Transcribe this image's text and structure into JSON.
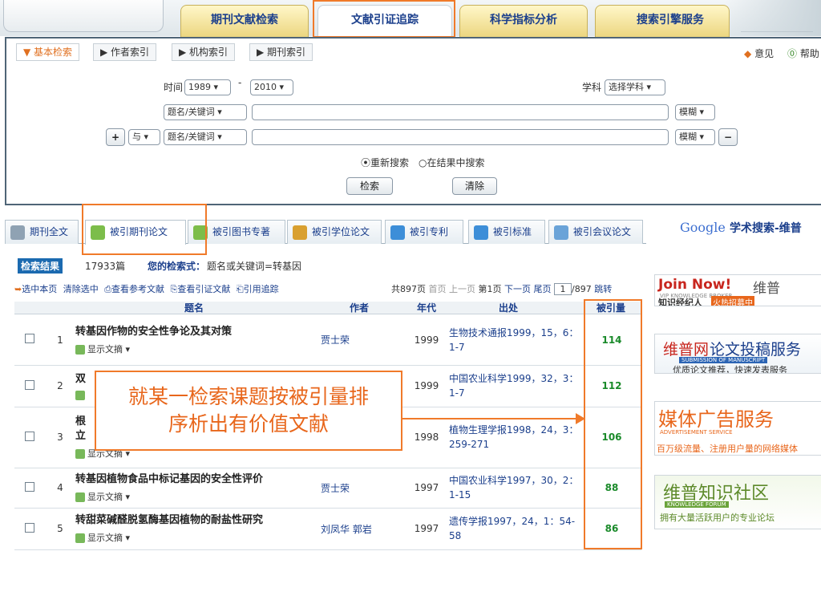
{
  "top_nav": {
    "tabs": [
      {
        "label": "期刊文献检索",
        "active": false
      },
      {
        "label": "文献引证追踪",
        "active": true
      },
      {
        "label": "科学指标分析",
        "active": false
      },
      {
        "label": "搜索引擎服务",
        "active": false
      }
    ]
  },
  "search": {
    "tabs": [
      {
        "label": "▼ 基本检索",
        "active": true
      },
      {
        "label": "▶ 作者索引",
        "active": false
      },
      {
        "label": "▶ 机构索引",
        "active": false
      },
      {
        "label": "▶ 期刊索引",
        "active": false
      }
    ],
    "feedback_label": "意见",
    "help_label": "帮助",
    "time_label": "时间",
    "year_from": "1989 ▾",
    "year_dash": "-",
    "year_to": "2010 ▾",
    "subject_label": "学科",
    "subject_select": "选择学科 ▾",
    "field1": "题名/关键词 ▾",
    "field2": "题名/关键词 ▾",
    "match1": "模糊 ▾",
    "match2": "模糊 ▾",
    "plus": "+",
    "minus": "−",
    "logic": "与 ▾",
    "radio_new": "重新搜索",
    "radio_in_results": "在结果中搜索",
    "search_btn": "检索",
    "clear_btn": "清除"
  },
  "result_tabs": [
    {
      "label": "期刊全文",
      "active": false,
      "color": "#7a8da0"
    },
    {
      "label": "被引期刊论文",
      "active": true,
      "color": "#7cbd4a"
    },
    {
      "label": "被引图书专著",
      "active": false,
      "color": "#7cbd4a"
    },
    {
      "label": "被引学位论文",
      "active": false,
      "color": "#d9a030"
    },
    {
      "label": "被引专利",
      "active": false,
      "color": "#3d8ed8"
    },
    {
      "label": "被引标准",
      "active": false,
      "color": "#3d8ed8"
    },
    {
      "label": "被引会议论文",
      "active": false,
      "color": "#6aa3d8"
    }
  ],
  "results": {
    "badge": "检索结果",
    "count": "17933篇",
    "query_label": "您的检索式：",
    "query": "题名或关键词=转基因",
    "toolbar": [
      "选中本页",
      "清除选中",
      "查看参考文献",
      "查看引证文献",
      "引用追踪"
    ],
    "pager": {
      "total": "共897页",
      "first": "首页",
      "prev": "上一页",
      "current": "第1页",
      "next": "下一页",
      "last": "尾页",
      "page_input": "1",
      "of": "/897",
      "go": "跳转"
    },
    "columns": {
      "title": "题名",
      "author": "作者",
      "year": "年代",
      "source": "出处",
      "cited": "被引量"
    },
    "show_abstract": "显示文摘 ▾",
    "rows": [
      {
        "n": "1",
        "title": "转基因作物的安全性争论及其对策",
        "author": "贾士荣",
        "year": "1999",
        "source": "生物技术通报1999，15，6：1-7",
        "cited": "114"
      },
      {
        "n": "2",
        "title": "双",
        "author": "",
        "year": "1999",
        "source": "中国农业科学1999，32，3：1-7",
        "cited": "112"
      },
      {
        "n": "3",
        "title": "根",
        "title2": "立",
        "author": "",
        "year": "1998",
        "source": "植物生理学报1998，24，3：259-271",
        "cited": "106"
      },
      {
        "n": "4",
        "title": "转基因植物食品中标记基因的安全性评价",
        "author": "贾士荣",
        "year": "1997",
        "source": "中国农业科学1997，30，2：1-15",
        "cited": "88"
      },
      {
        "n": "5",
        "title": "转甜菜碱醛脱氢酶基因植物的耐盐性研究",
        "author": "刘凤华 郭岩",
        "year": "1997",
        "source": "遗传学报1997，24，1：54-58",
        "cited": "86"
      }
    ]
  },
  "callout": {
    "line1": "就某一检索课题按被引量排",
    "line2": "序析出有价值文献"
  },
  "sidebar": {
    "google_label": "Google",
    "google_suffix": "学术搜索-维普",
    "ad1": {
      "title": "Join Now!",
      "brand": "维普",
      "sub": "VIP KNOWLEDGE BROKER",
      "line": "知识经纪人",
      "tag": "火热招募中"
    },
    "ad2": {
      "title_a": "维普网",
      "title_b": "论文投稿服务",
      "sub": "SUBMISSION OF MANUSCRIPT",
      "line": "优质论文推荐，快速发表服务"
    },
    "ad3": {
      "title": "媒体广告服务",
      "sub": "ADVERTISEMENT SERVICE",
      "line": "百万级流量、注册用户量的网络媒体"
    },
    "ad4": {
      "title": "维普知识社区",
      "sub": "KNOWLEDGE FORUM",
      "line": "拥有大量活跃用户的专业论坛"
    }
  }
}
